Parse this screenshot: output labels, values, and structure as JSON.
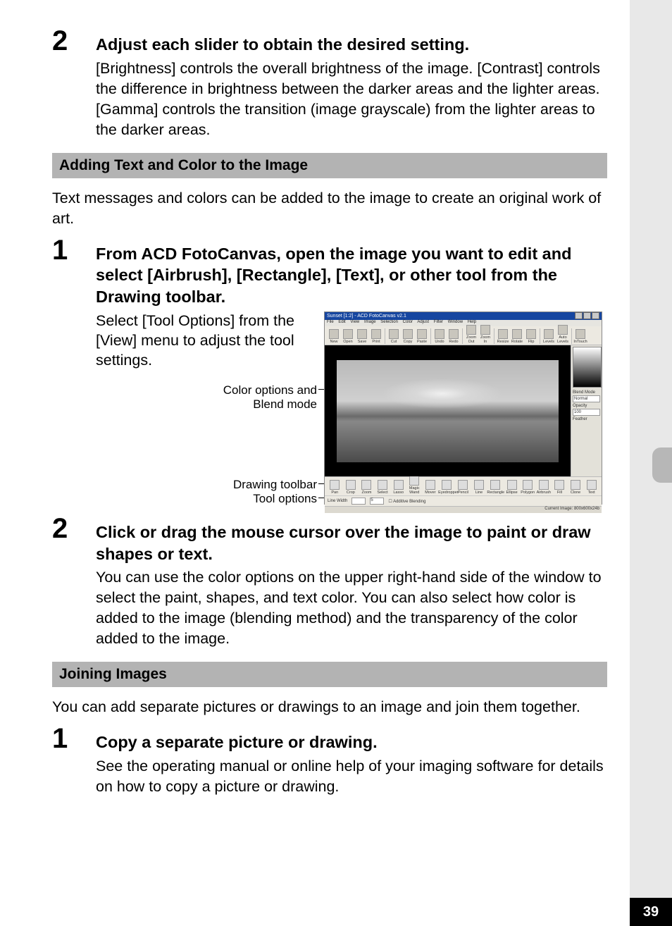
{
  "page_number": "39",
  "step2a": {
    "num": "2",
    "head": "Adjust each slider to obtain the desired setting.",
    "desc": "[Brightness] controls the overall brightness of the image. [Contrast] controls the difference in brightness between the darker areas and the lighter areas. [Gamma] controls the transition (image grayscale) from the lighter areas to the darker areas."
  },
  "section_add": "Adding Text and Color to the Image",
  "para_add": "Text messages and colors can be added to the image to create an original work of art.",
  "step1b": {
    "num": "1",
    "head": "From ACD FotoCanvas, open the image you want to edit and select [Airbrush], [Rectangle], [Text], or other tool from the Drawing toolbar.",
    "side_text": "Select [Tool Options] from the [View] menu to adjust the tool settings.",
    "callouts": {
      "color_blend": "Color options and\nBlend mode",
      "draw_tb": "Drawing toolbar",
      "tool_opts": "Tool options"
    }
  },
  "step2b": {
    "num": "2",
    "head": "Click or drag the mouse cursor over the image to paint or draw shapes or text.",
    "desc": "You can use the color options on the upper right-hand side of the window to select the paint, shapes, and text color. You can also select how color is added to the image (blending method) and the transparency of the color added to the image."
  },
  "section_join": "Joining Images",
  "para_join": "You can add separate pictures or drawings to an image and join them together.",
  "step1c": {
    "num": "1",
    "head": "Copy a separate picture or drawing.",
    "desc": "See the operating manual or online help of your imaging software for details on how to copy a picture or drawing."
  },
  "mini": {
    "title": "Sunset [1:2] - ACD FotoCanvas v2.1",
    "menus": [
      "File",
      "Edit",
      "View",
      "Image",
      "Selection",
      "Color",
      "Adjust",
      "Filter",
      "Window",
      "Help"
    ],
    "toolbar_top": [
      "New",
      "Open",
      "Save",
      "Print",
      "Cut",
      "Copy",
      "Paste",
      "Undo",
      "Redo",
      "Zoom Out",
      "Zoom In",
      "Resize",
      "Rotate",
      "Flip",
      "Levels",
      "Auto Levels",
      "InTouch"
    ],
    "right_panel": {
      "blend_label": "Blend Mode",
      "blend_value": "Normal",
      "opacity_label": "Opacity",
      "opacity_value": "100",
      "feather_label": "Feather"
    },
    "toolbar_draw": [
      "Pan",
      "Crop",
      "Zoom",
      "Select",
      "Lasso",
      "Magic Wand",
      "Mover",
      "Eyedropper",
      "Pencil",
      "Line",
      "Rectangle",
      "Ellipse",
      "Polygon",
      "Airbrush",
      "Fill",
      "Clone",
      "Text"
    ],
    "opts": {
      "line_width_label": "Line Width",
      "line_width_val": "5",
      "additive": "Additive Blending"
    },
    "status": "Current Image: 800x600x24b"
  }
}
